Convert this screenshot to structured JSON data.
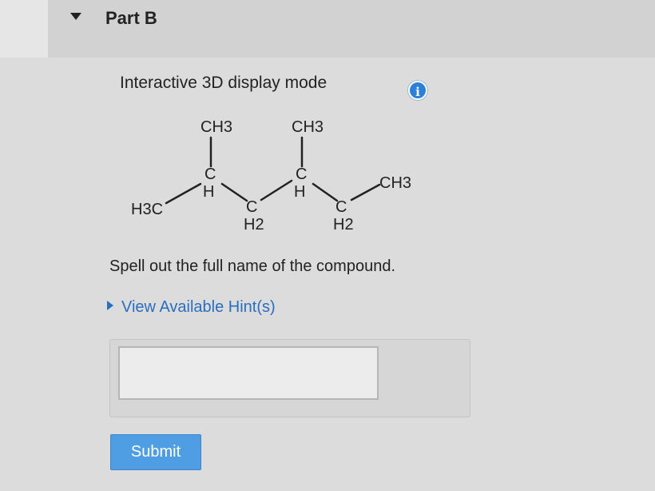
{
  "part": {
    "title": "Part B"
  },
  "display": {
    "mode_label": "Interactive 3D display mode"
  },
  "structure": {
    "branch1": "CH3",
    "branch2": "CH3",
    "left_end": "H3C",
    "right_end": "CH3",
    "ch_group": "C",
    "h_label": "H",
    "ch2_group": "C",
    "h2_label": "H2"
  },
  "question": {
    "prompt": "Spell out the full name of the compound."
  },
  "hint": {
    "label": "View Available Hint(s)"
  },
  "answer": {
    "value": "",
    "placeholder": ""
  },
  "submit": {
    "label": "Submit"
  },
  "colors": {
    "accent": "#4f9de3",
    "link": "#2a6ebf",
    "info": "#2e7fd6"
  }
}
